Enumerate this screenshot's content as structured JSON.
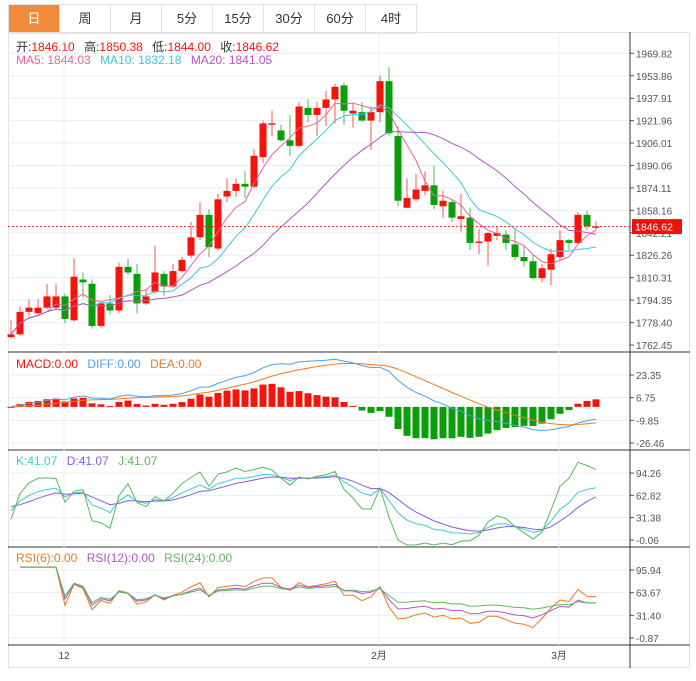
{
  "tabs": [
    {
      "label": "日",
      "active": true
    },
    {
      "label": "周"
    },
    {
      "label": "月"
    },
    {
      "label": "5分"
    },
    {
      "label": "15分"
    },
    {
      "label": "30分"
    },
    {
      "label": "60分"
    },
    {
      "label": "4时"
    }
  ],
  "ohlc_legend": {
    "open_label": "开:",
    "open": "1846.10",
    "high_label": "高:",
    "high": "1850.38",
    "low_label": "低:",
    "low": "1844.00",
    "close_label": "收:",
    "close": "1846.62"
  },
  "ma_legend": {
    "ma5": "MA5: 1844.03",
    "ma10": "MA10: 1832.18",
    "ma20": "MA20: 1841.05"
  },
  "macd_legend": {
    "macd": "MACD:0.00",
    "diff": "DIFF:0.00",
    "dea": "DEA:0.00"
  },
  "kdj_legend": {
    "k": "K:41.07",
    "d": "D:41.07",
    "j": "J:41.07"
  },
  "rsi_legend": {
    "rsi6": "RSI(6):0.00",
    "rsi12": "RSI(12):0.00",
    "rsi24": "RSI(24):0.00"
  },
  "current_price": "1846.62",
  "colors": {
    "up": "#f5140a",
    "down": "#0a9e0a",
    "accent": "#f08c3c",
    "ma5": "#f0609a",
    "ma10": "#3cc8dc",
    "ma20": "#b455c8",
    "diff": "#4aa0f0",
    "dea": "#f07820",
    "k": "#3cc8dc",
    "d": "#8a5cd8",
    "j": "#5cb85c",
    "rsi6": "#f07820",
    "rsi12": "#b455c8",
    "rsi24": "#5cb85c"
  },
  "chart_data": {
    "type": "candlestick",
    "price_ticks": [
      "1969.82",
      "1953.86",
      "1937.91",
      "1921.96",
      "1906.01",
      "1890.06",
      "1874.11",
      "1858.16",
      "1842.21",
      "1826.26",
      "1810.31",
      "1794.35",
      "1778.40",
      "1762.45"
    ],
    "macd_ticks": [
      "23.35",
      "6.75",
      "-9.85",
      "-26.46"
    ],
    "kdj_ticks": [
      "94.26",
      "62.82",
      "31.38",
      "-0.06"
    ],
    "rsi_ticks": [
      "95.94",
      "63.67",
      "31.40",
      "-0.87"
    ],
    "x_labels": [
      {
        "label": "12",
        "index": 6
      },
      {
        "label": "2月",
        "index": 41
      },
      {
        "label": "3月",
        "index": 61
      }
    ],
    "ohlc": [
      [
        1768,
        1780,
        1767,
        1770
      ],
      [
        1770,
        1790,
        1769,
        1786
      ],
      [
        1786,
        1795,
        1783,
        1789
      ],
      [
        1785,
        1795,
        1784,
        1789
      ],
      [
        1789,
        1806,
        1788,
        1797
      ],
      [
        1789,
        1806,
        1788,
        1797
      ],
      [
        1797,
        1799,
        1778,
        1781
      ],
      [
        1780,
        1824,
        1779,
        1811
      ],
      [
        1809,
        1814,
        1796,
        1807
      ],
      [
        1806,
        1809,
        1774,
        1776
      ],
      [
        1776,
        1793,
        1775,
        1792
      ],
      [
        1792,
        1798,
        1784,
        1787
      ],
      [
        1787,
        1821,
        1785,
        1818
      ],
      [
        1818,
        1824,
        1812,
        1814
      ],
      [
        1813,
        1820,
        1785,
        1792
      ],
      [
        1792,
        1802,
        1791,
        1797
      ],
      [
        1800,
        1833,
        1799,
        1814
      ],
      [
        1813,
        1815,
        1797,
        1804
      ],
      [
        1804,
        1820,
        1803,
        1815
      ],
      [
        1815,
        1825,
        1814,
        1823
      ],
      [
        1826,
        1850,
        1824,
        1839
      ],
      [
        1839,
        1864,
        1837,
        1855
      ],
      [
        1855,
        1859,
        1825,
        1832
      ],
      [
        1831,
        1870,
        1830,
        1866
      ],
      [
        1868,
        1881,
        1864,
        1872
      ],
      [
        1872,
        1881,
        1868,
        1877
      ],
      [
        1877,
        1886,
        1867,
        1875
      ],
      [
        1875,
        1902,
        1874,
        1897
      ],
      [
        1896,
        1922,
        1892,
        1920
      ],
      [
        1919,
        1929,
        1911,
        1920
      ],
      [
        1915,
        1919,
        1907,
        1908
      ],
      [
        1908,
        1926,
        1897,
        1904
      ],
      [
        1904,
        1935,
        1903,
        1932
      ],
      [
        1931,
        1937,
        1921,
        1926
      ],
      [
        1926,
        1935,
        1911,
        1931
      ],
      [
        1931,
        1943,
        1918,
        1937
      ],
      [
        1937,
        1948,
        1920,
        1946
      ],
      [
        1947,
        1949,
        1919,
        1929
      ],
      [
        1927,
        1934,
        1917,
        1929
      ],
      [
        1928,
        1935,
        1921,
        1922
      ],
      [
        1922,
        1932,
        1901,
        1928
      ],
      [
        1928,
        1954,
        1921,
        1950
      ],
      [
        1950,
        1960,
        1911,
        1913
      ],
      [
        1911,
        1918,
        1861,
        1865
      ],
      [
        1860,
        1881,
        1860,
        1867
      ],
      [
        1866,
        1884,
        1865,
        1873
      ],
      [
        1872,
        1886,
        1869,
        1876
      ],
      [
        1876,
        1890,
        1859,
        1862
      ],
      [
        1861,
        1872,
        1853,
        1865
      ],
      [
        1864,
        1866,
        1850,
        1853
      ],
      [
        1852,
        1870,
        1843,
        1854
      ],
      [
        1853,
        1860,
        1830,
        1835
      ],
      [
        1835,
        1845,
        1827,
        1836
      ],
      [
        1836,
        1843,
        1819,
        1842
      ],
      [
        1840,
        1847,
        1837,
        1842
      ],
      [
        1841,
        1844,
        1830,
        1835
      ],
      [
        1834,
        1846,
        1823,
        1825
      ],
      [
        1825,
        1833,
        1818,
        1822
      ],
      [
        1822,
        1827,
        1809,
        1810
      ],
      [
        1810,
        1820,
        1807,
        1817
      ],
      [
        1816,
        1831,
        1805,
        1827
      ],
      [
        1825,
        1844,
        1823,
        1837
      ],
      [
        1837,
        1838,
        1830,
        1835
      ],
      [
        1835,
        1857,
        1834,
        1855
      ],
      [
        1855,
        1858,
        1844,
        1847
      ],
      [
        1846.1,
        1850.38,
        1844.0,
        1846.62
      ]
    ]
  }
}
